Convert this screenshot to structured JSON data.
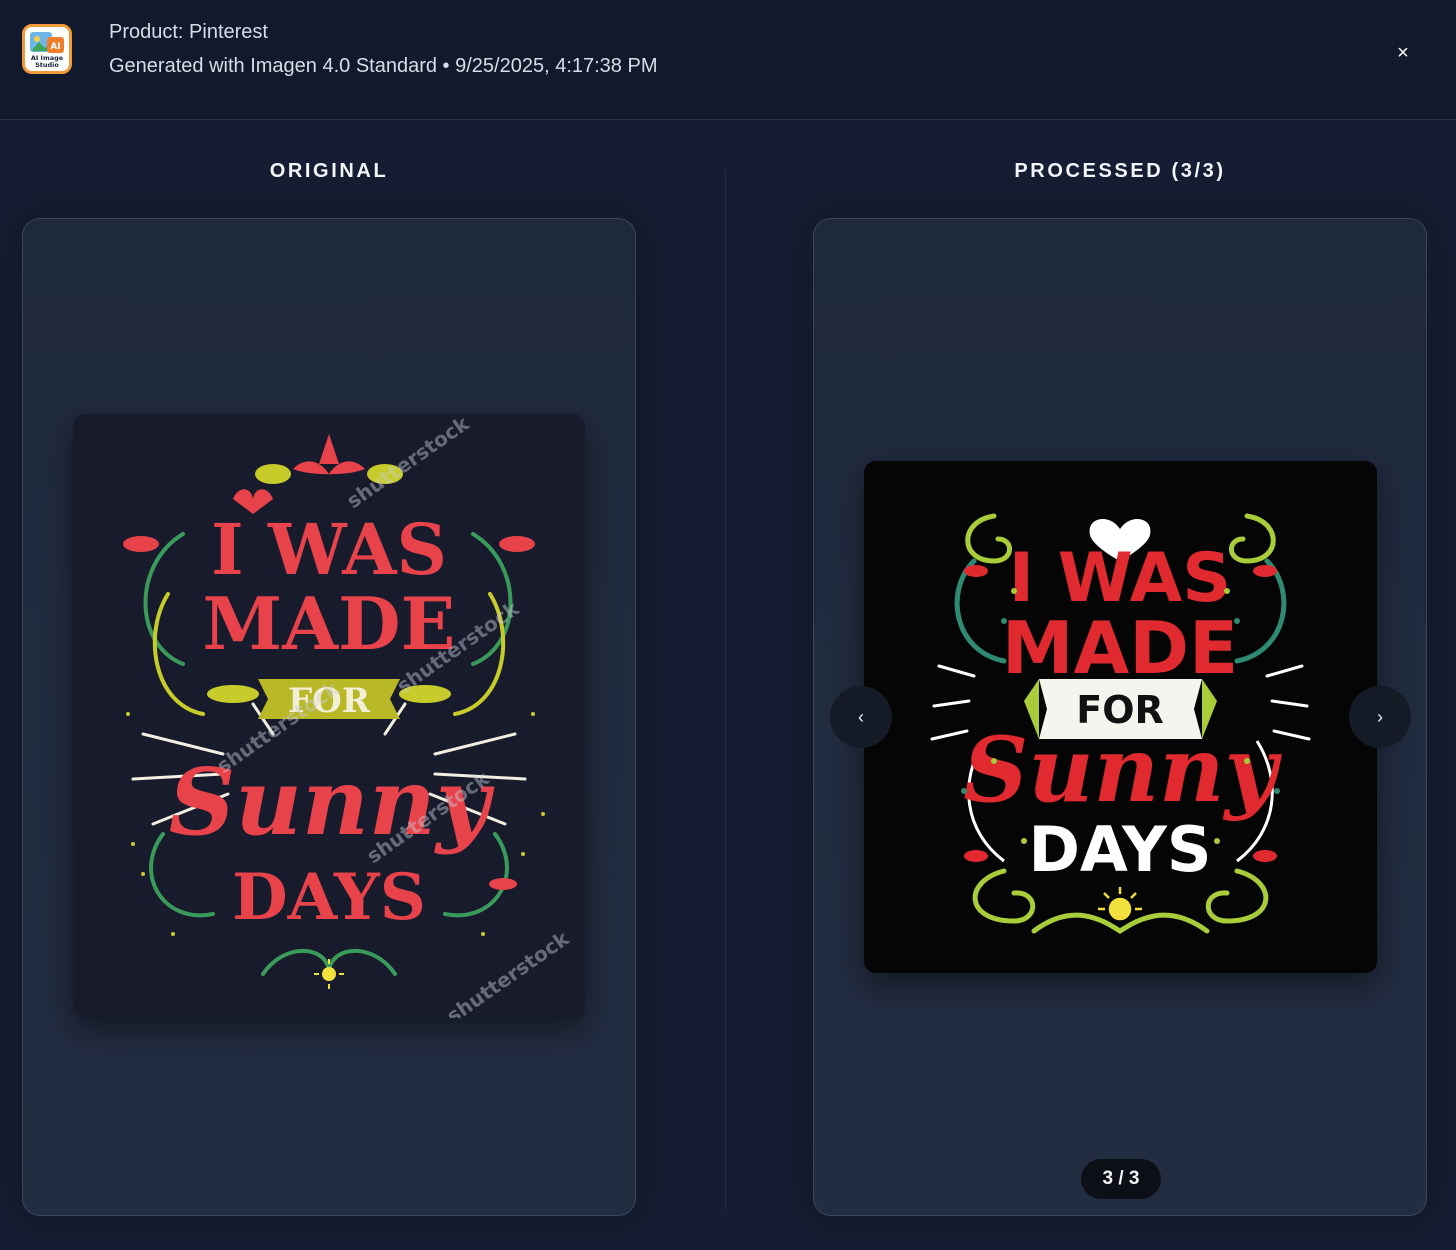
{
  "header": {
    "product_line": "Product: Pinterest",
    "meta_line": "Generated with Imagen 4.0 Standard • 9/25/2025, 4:17:38 PM",
    "logo_text": "AI Image Studio",
    "close_label": "×"
  },
  "columns": {
    "original_title": "ORIGINAL",
    "processed_title": "PROCESSED (3/3)"
  },
  "artwork": {
    "line1": "I WAS",
    "line2": "MADE",
    "line3": "FOR",
    "line4": "Sunny",
    "line5": "DAYS",
    "watermark": "shutterstock"
  },
  "carousel": {
    "prev_label": "‹",
    "next_label": "›",
    "counter": "3 / 3"
  },
  "colors": {
    "background": "#141d31",
    "header_bg": "#111a2c",
    "accent_red": "#e8424a",
    "accent_yellow": "#c8cc2a",
    "accent_green": "#3a9a5a"
  }
}
